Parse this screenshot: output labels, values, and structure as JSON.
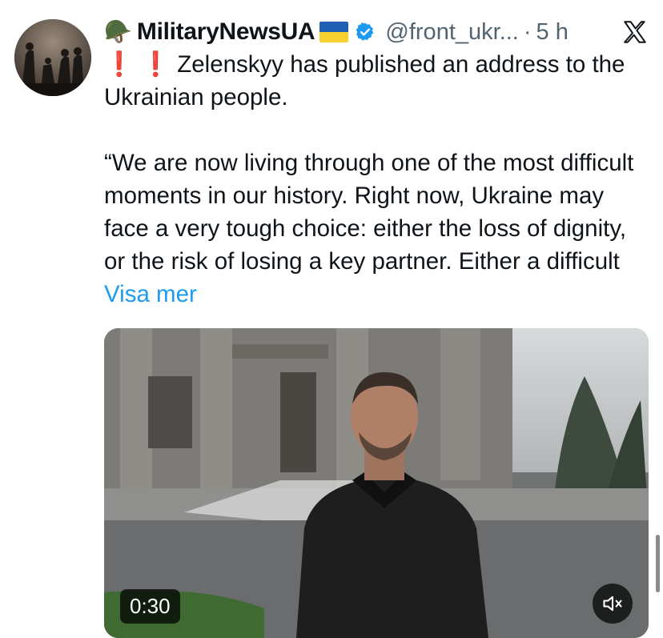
{
  "author": {
    "display_name": "MilitaryNewsUA",
    "handle": "@front_ukr...",
    "separator": "·",
    "time": "5 h",
    "verified_icon": "verified-badge-icon",
    "flag_colors": [
      "#1f5fb4",
      "#f7d12e"
    ]
  },
  "tweet": {
    "prefix": "❗ ❗",
    "text": " Zelenskyy has published an address to the Ukrainian people.\n\n“We are now living through one of the most difficult moments in our history. Right now, Ukraine may face a very tough choice: either the loss of dignity, or the risk of losing a key partner. Either a difficult ",
    "show_more": "Visa mer"
  },
  "video": {
    "duration": "0:30",
    "muted": true
  },
  "colors": {
    "link": "#1d9bf0",
    "secondary_text": "#536471",
    "alert": "#e0102b"
  }
}
